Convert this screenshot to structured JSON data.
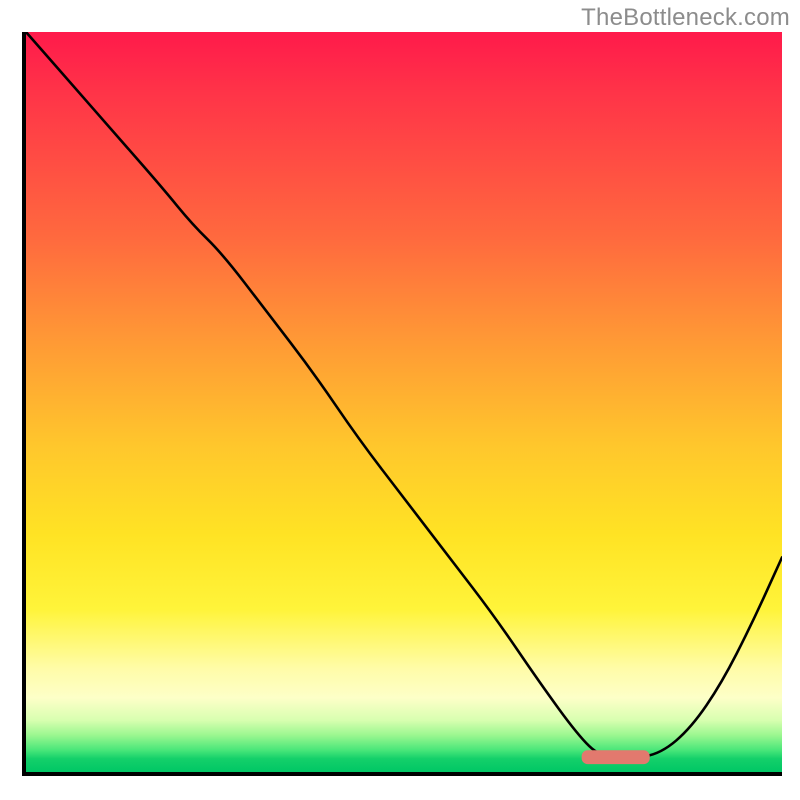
{
  "watermark": "TheBottleneck.com",
  "chart_data": {
    "type": "line",
    "title": "",
    "xlabel": "",
    "ylabel": "",
    "xlim": [
      0,
      100
    ],
    "ylim": [
      0,
      100
    ],
    "grid": false,
    "legend": false,
    "background_gradient": {
      "direction": "vertical",
      "stops": [
        {
          "pos": 0.0,
          "color": "#ff1a4b"
        },
        {
          "pos": 0.28,
          "color": "#ff6a3e"
        },
        {
          "pos": 0.56,
          "color": "#ffc72c"
        },
        {
          "pos": 0.78,
          "color": "#fff43a"
        },
        {
          "pos": 0.9,
          "color": "#fdffc8"
        },
        {
          "pos": 0.97,
          "color": "#4be77a"
        },
        {
          "pos": 1.0,
          "color": "#00c765"
        }
      ]
    },
    "series": [
      {
        "name": "bottleneck-curve",
        "x": [
          0,
          6,
          12,
          18,
          22,
          26,
          32,
          38,
          44,
          50,
          56,
          62,
          68,
          73,
          76,
          80,
          84,
          88,
          92,
          96,
          100
        ],
        "y": [
          100,
          93,
          86,
          79,
          74,
          70,
          62,
          54,
          45,
          37,
          29,
          21,
          12,
          5,
          2,
          1.8,
          2.5,
          6,
          12,
          20,
          29
        ]
      }
    ],
    "marker": {
      "name": "optimal-range",
      "shape": "rounded-bar",
      "x_start": 73.5,
      "x_end": 82.5,
      "y": 2.0,
      "color": "#e2796e"
    }
  }
}
